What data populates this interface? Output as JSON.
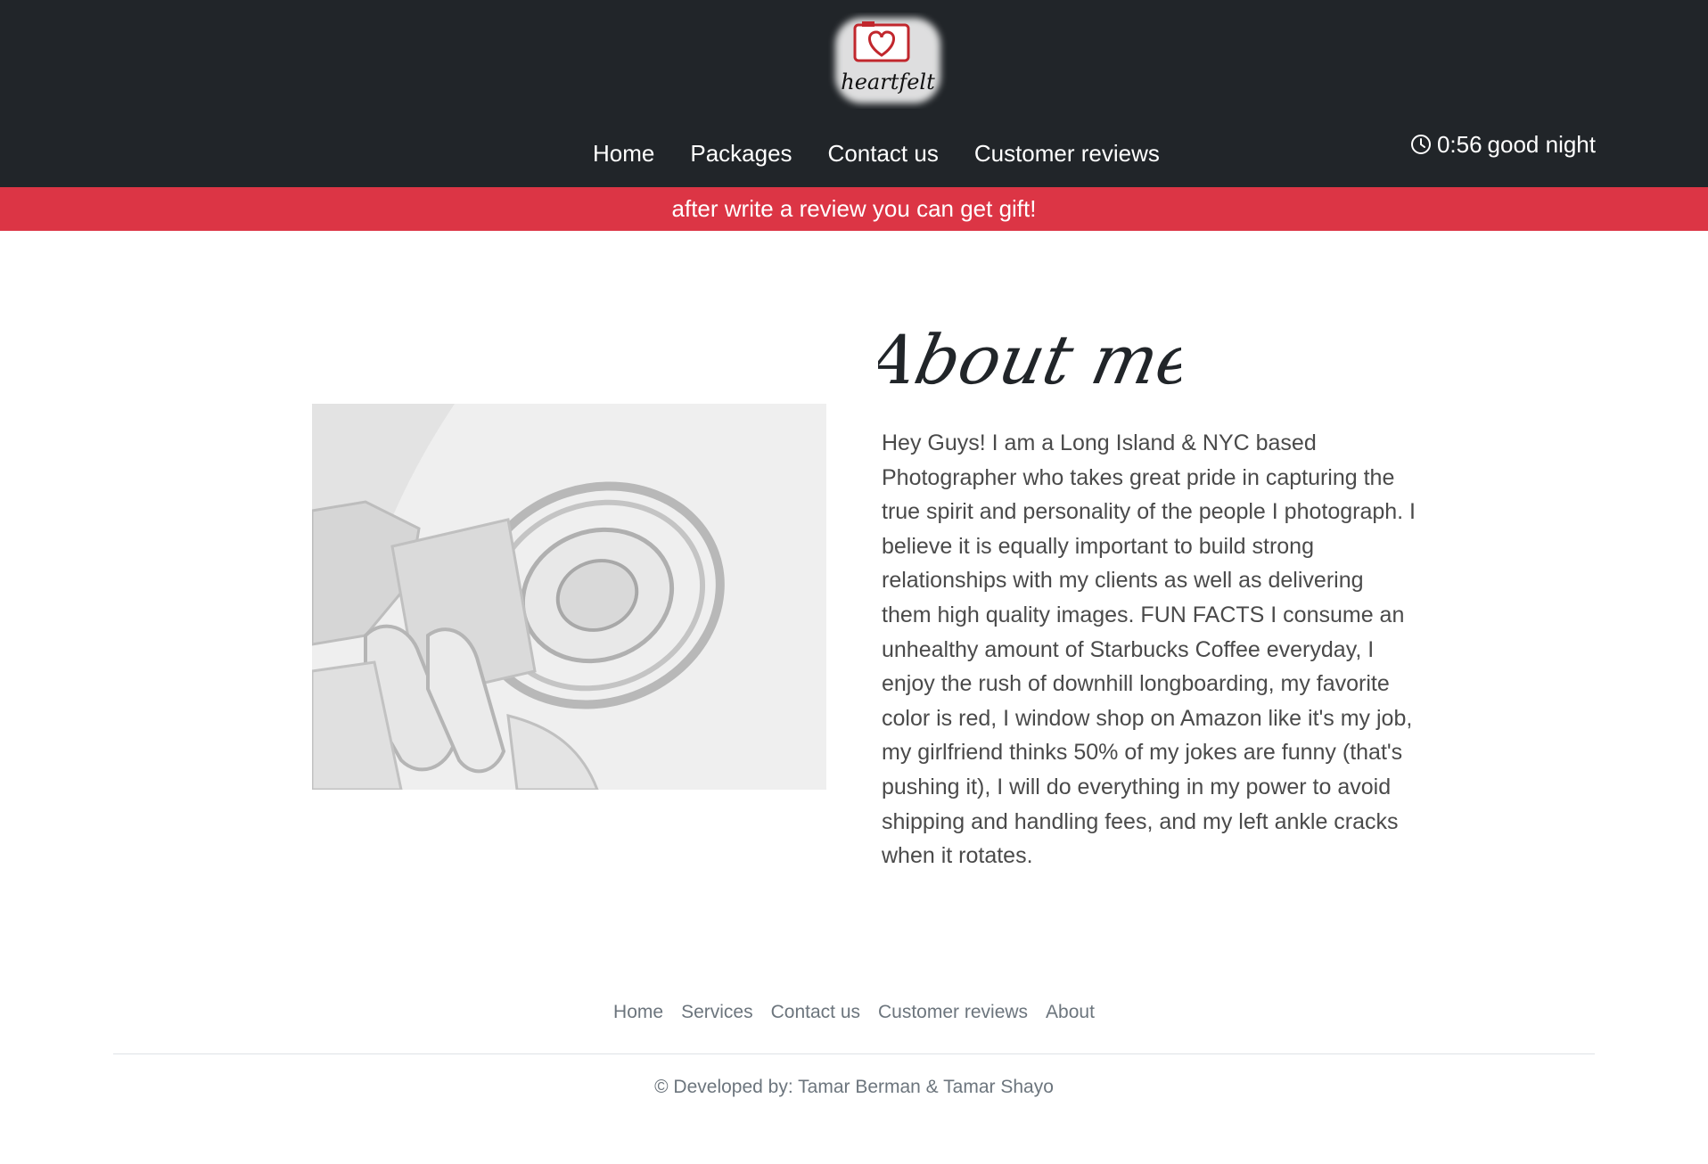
{
  "brand": {
    "logo_text": "heartfelt"
  },
  "nav": {
    "items": [
      {
        "label": "Home"
      },
      {
        "label": "Packages"
      },
      {
        "label": "Contact us"
      },
      {
        "label": "Customer reviews"
      }
    ]
  },
  "clock": {
    "time": "0:56",
    "greeting": "good night",
    "icon": "clock-icon"
  },
  "banner": {
    "text": "after write a review you can get gift!"
  },
  "about": {
    "title": "About me -",
    "body": "Hey Guys! I am a Long Island & NYC based Photographer who takes great pride in capturing the true spirit and personality of the people I photograph. I believe it is equally important to build strong relationships with my clients as well as delivering them high quality images. FUN FACTS I consume an unhealthy amount of Starbucks Coffee everyday, I enjoy the rush of downhill longboarding, my favorite color is red, I window shop on Amazon like it's my job, my girlfriend thinks 50% of my jokes are funny (that's pushing it), I will do everything in my power to avoid shipping and handling fees, and my left ankle cracks when it rotates."
  },
  "footer": {
    "links": [
      {
        "label": "Home"
      },
      {
        "label": "Services"
      },
      {
        "label": "Contact us"
      },
      {
        "label": "Customer reviews"
      },
      {
        "label": "About"
      }
    ],
    "copyright": "© Developed by: Tamar Berman & Tamar Shayo"
  },
  "colors": {
    "header_bg": "#212529",
    "banner_bg": "#dc3545",
    "footer_text": "#6c757d"
  }
}
